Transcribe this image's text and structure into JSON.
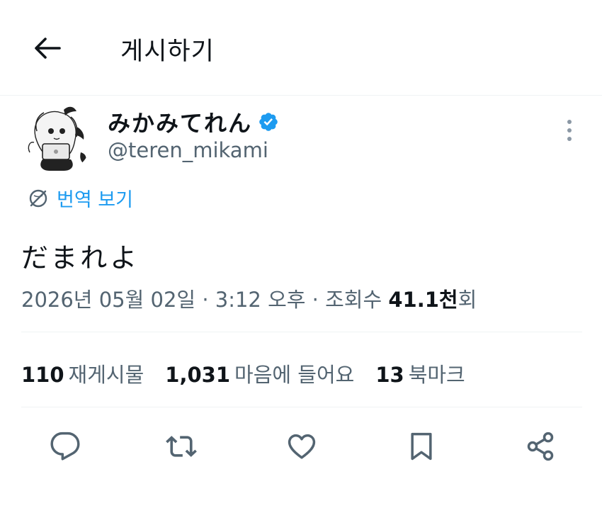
{
  "header": {
    "title": "게시하기",
    "back_icon": "arrow-left-icon"
  },
  "author": {
    "display_name": "みかみてれん",
    "handle": "@teren_mikami",
    "verified": true,
    "verified_color": "#1d9bf0"
  },
  "translate": {
    "label": "번역 보기",
    "icon": "globe-icon"
  },
  "tweet": {
    "text": "だまれよ",
    "date": "2026년 05월 02일",
    "separator": "·",
    "time": "3:12 오후",
    "views_label": "조회수",
    "views_count": "41.1천",
    "views_suffix": "회"
  },
  "stats": {
    "reposts": {
      "count": "110",
      "label": "재게시물"
    },
    "likes": {
      "count": "1,031",
      "label": "마음에 들어요"
    },
    "bookmarks": {
      "count": "13",
      "label": "북마크"
    }
  },
  "actions": [
    "reply-icon",
    "repost-icon",
    "like-icon",
    "bookmark-icon",
    "share-icon"
  ],
  "colors": {
    "accent": "#1d9bf0",
    "secondary_text": "#536471",
    "primary_text": "#0f1419"
  }
}
